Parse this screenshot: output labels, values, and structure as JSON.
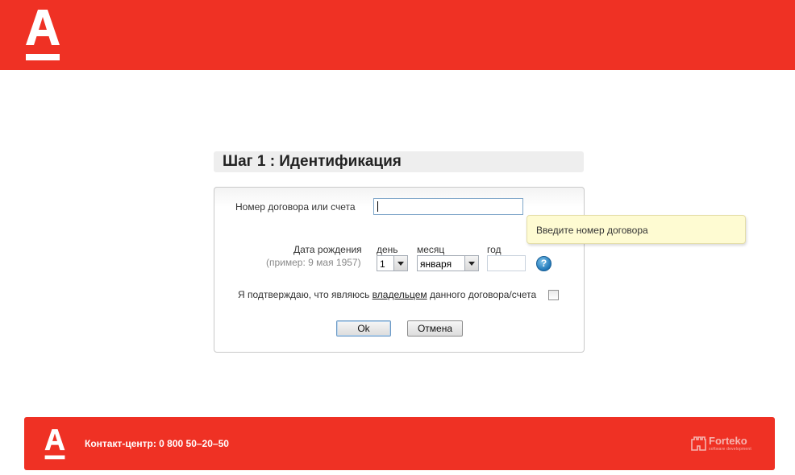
{
  "header": {
    "logo": "alfa-bank-logo"
  },
  "step": {
    "title": "Шаг 1 : Идентификация"
  },
  "form": {
    "contract_label": "Номер договора или счета",
    "contract_value": "",
    "birth_label": "Дата рождения",
    "birth_hint": "(пример: 9 мая 1957)",
    "day_label": "день",
    "month_label": "месяц",
    "year_label": "год",
    "day_value": "1",
    "month_value": "января",
    "year_value": "",
    "help_icon_glyph": "?",
    "confirm_prefix": "Я подтверждаю, что являюсь ",
    "confirm_link": "владельцем",
    "confirm_suffix": " данного договора/счета",
    "confirm_checked": false,
    "ok_label": "Ok",
    "cancel_label": "Отмена"
  },
  "tooltip": {
    "text": "Введите номер договора"
  },
  "footer": {
    "contact": "Контакт-центр: 0 800 50–20–50",
    "brand": "Forteko",
    "brand_sub": "software development"
  },
  "colors": {
    "brand_red": "#ef3124",
    "tooltip_bg": "#fefbd2",
    "help_blue": "#1f77b8"
  }
}
